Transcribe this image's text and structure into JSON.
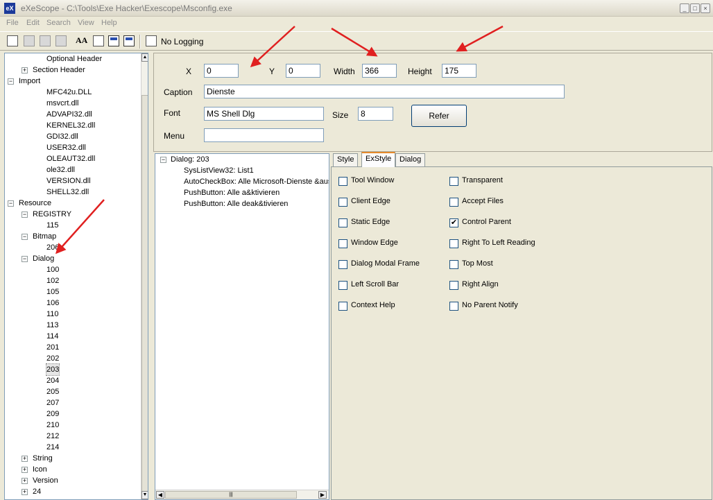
{
  "window": {
    "title": "eXeScope - C:\\Tools\\Exe Hacker\\Exescope\\Msconfig.exe",
    "app_icon": "eX"
  },
  "menu": [
    "File",
    "Edit",
    "Search",
    "View",
    "Help"
  ],
  "toolbar": {
    "font_button_text": "AA",
    "logging_label": "No Logging"
  },
  "tree": {
    "items": [
      {
        "label": "Optional Header"
      },
      {
        "label": "Section Header",
        "expander": "+"
      },
      {
        "label": "Import",
        "expander": "−"
      },
      {
        "label": "MFC42u.DLL"
      },
      {
        "label": "msvcrt.dll"
      },
      {
        "label": "ADVAPI32.dll"
      },
      {
        "label": "KERNEL32.dll"
      },
      {
        "label": "GDI32.dll"
      },
      {
        "label": "USER32.dll"
      },
      {
        "label": "OLEAUT32.dll"
      },
      {
        "label": "ole32.dll"
      },
      {
        "label": "VERSION.dll"
      },
      {
        "label": "SHELL32.dll"
      },
      {
        "label": "Resource",
        "expander": "−"
      },
      {
        "label": "REGISTRY",
        "expander": "−"
      },
      {
        "label": "115"
      },
      {
        "label": "Bitmap",
        "expander": "−"
      },
      {
        "label": "206"
      },
      {
        "label": "Dialog",
        "expander": "−"
      },
      {
        "label": "100"
      },
      {
        "label": "102"
      },
      {
        "label": "105"
      },
      {
        "label": "106"
      },
      {
        "label": "110"
      },
      {
        "label": "113"
      },
      {
        "label": "114"
      },
      {
        "label": "201"
      },
      {
        "label": "202"
      },
      {
        "label": "203",
        "selected": true
      },
      {
        "label": "204"
      },
      {
        "label": "205"
      },
      {
        "label": "207"
      },
      {
        "label": "209"
      },
      {
        "label": "210"
      },
      {
        "label": "212"
      },
      {
        "label": "214"
      },
      {
        "label": "String",
        "expander": "+"
      },
      {
        "label": "Icon",
        "expander": "+"
      },
      {
        "label": "Version",
        "expander": "+"
      },
      {
        "label": "24",
        "expander": "+"
      }
    ]
  },
  "properties": {
    "x_label": "X",
    "x_value": "0",
    "y_label": "Y",
    "y_value": "0",
    "width_label": "Width",
    "width_value": "366",
    "height_label": "Height",
    "height_value": "175",
    "caption_label": "Caption",
    "caption_value": "Dienste",
    "font_label": "Font",
    "font_value": "MS Shell Dlg",
    "size_label": "Size",
    "size_value": "8",
    "menu_label": "Menu",
    "menu_value": "",
    "refer_label": "Refer"
  },
  "controls": {
    "root": "Dialog: 203",
    "root_expander": "−",
    "items": [
      "SysListView32: List1",
      "AutoCheckBox: Alle Microsoft-Dienste &ausl",
      "PushButton: Alle a&ktivieren",
      "PushButton: Alle deak&tivieren"
    ],
    "scroll_left": "◀",
    "scroll_right": "▶",
    "scroll_grip": "|||"
  },
  "tabs": [
    "Style",
    "ExStyle",
    "Dialog"
  ],
  "active_tab": "ExStyle",
  "exstyle": {
    "left": [
      {
        "label": "Tool Window",
        "checked": false
      },
      {
        "label": "Client Edge",
        "checked": false
      },
      {
        "label": "Static Edge",
        "checked": false
      },
      {
        "label": "Window Edge",
        "checked": false
      },
      {
        "label": "Dialog Modal Frame",
        "checked": false
      },
      {
        "label": "Left Scroll Bar",
        "checked": false
      },
      {
        "label": "Context Help",
        "checked": false
      }
    ],
    "right": [
      {
        "label": "Transparent",
        "checked": false
      },
      {
        "label": "Accept Files",
        "checked": false
      },
      {
        "label": "Control Parent",
        "checked": true
      },
      {
        "label": "Right To Left Reading",
        "checked": false
      },
      {
        "label": "Top Most",
        "checked": false
      },
      {
        "label": "Right Align",
        "checked": false
      },
      {
        "label": "No Parent Notify",
        "checked": false
      }
    ]
  },
  "colors": {
    "annotation_arrow": "#e02020",
    "tab_highlight": "#e68b2c"
  }
}
